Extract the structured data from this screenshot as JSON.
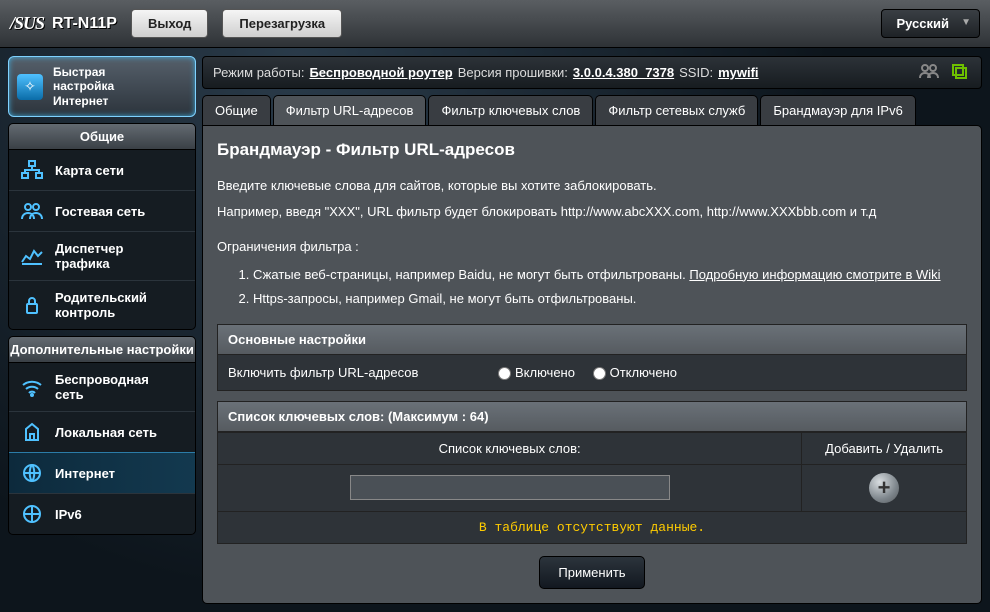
{
  "header": {
    "brand": "/SUS",
    "model": "RT-N11P",
    "logout_btn": "Выход",
    "reboot_btn": "Перезагрузка",
    "language": "Русский"
  },
  "qis": {
    "line1": "Быстрая",
    "line2": "настройка",
    "line3": "Интернет"
  },
  "nav_general": {
    "title": "Общие",
    "map": "Карта сети",
    "guest": "Гостевая сеть",
    "traffic1": "Диспетчер",
    "traffic2": "трафика",
    "parental1": "Родительский",
    "parental2": "контроль"
  },
  "nav_adv": {
    "title": "Дополнительные настройки",
    "wireless1": "Беспроводная",
    "wireless2": "сеть",
    "lan": "Локальная сеть",
    "wan": "Интернет",
    "ipv6": "IPv6"
  },
  "status": {
    "mode_lbl": "Режим работы: ",
    "mode_val": "Беспроводной роутер",
    "fw_lbl": " Версия прошивки: ",
    "fw_val": "3.0.0.4.380_7378",
    "ssid_lbl": " SSID: ",
    "ssid_val": "mywifi"
  },
  "tabs": {
    "t0": "Общие",
    "t1": "Фильтр URL-адресов",
    "t2": "Фильтр ключевых слов",
    "t3": "Фильтр сетевых служб",
    "t4": "Брандмауэр для IPv6"
  },
  "page": {
    "title": "Брандмауэр - Фильтр URL-адресов",
    "intro1": "Введите ключевые слова для сайтов, которые вы хотите заблокировать.",
    "intro2": "Например, введя \"XXX\", URL фильтр будет блокировать http://www.abcXXX.com, http://www.XXXbbb.com и т.д",
    "limits_head": "Ограничения фильтра :",
    "limit1_a": "Сжатые веб-страницы, например Baidu, не могут быть отфильтрованы. ",
    "limit1_link": "Подробную информацию смотрите в Wiki",
    "limit2": "Https-запросы, например Gmail, не могут быть отфильтрованы.",
    "section_basic": "Основные настройки",
    "enable_label": "Включить фильтр URL-адресов",
    "radio_on": "Включено",
    "radio_off": "Отключено",
    "section_list_a": "Список ключевых слов: (Максимум : ",
    "section_list_max": "64",
    "section_list_b": ")",
    "col_keyword": "Список ключевых слов:",
    "col_action": "Добавить / Удалить",
    "empty": "В таблице отсутствуют данные.",
    "apply": "Применить"
  }
}
